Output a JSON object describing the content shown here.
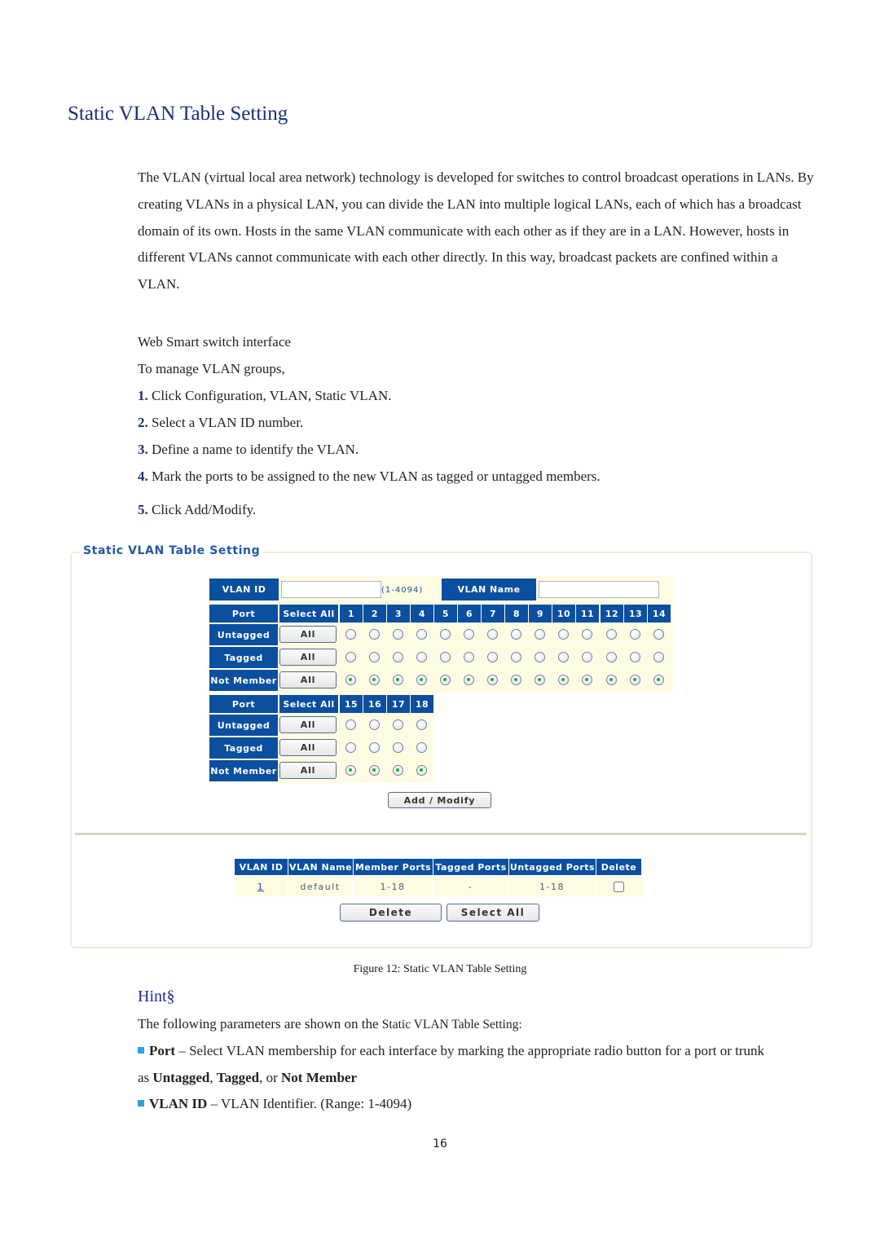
{
  "heading": "Static VLAN Table Setting",
  "intro": "The VLAN (virtual local area network) technology is developed for switches to control broadcast operations in LANs. By creating VLANs in a physical LAN, you can divide the LAN into multiple logical LANs, each of which has a broadcast domain of its own. Hosts in the same VLAN communicate with each other as if they are in a LAN. However, hosts in different VLANs cannot communicate with each other directly. In this way, broadcast packets are confined within a VLAN.",
  "interface_label": "Web Smart switch interface",
  "manage_label": "To manage VLAN groups,",
  "steps": [
    {
      "num": "1.",
      "text": "Click Configuration, VLAN, Static VLAN."
    },
    {
      "num": "2.",
      "text": "Select a VLAN ID number."
    },
    {
      "num": "3.",
      "text": "Define a name to identify the VLAN."
    },
    {
      "num": "4.",
      "text": "Mark the ports to be assigned to the new VLAN as tagged or untagged members."
    },
    {
      "num": "5.",
      "text": "Click Add/Modify."
    }
  ],
  "figure": {
    "legend": "Static VLAN Table Setting",
    "vlan_id_label": "VLAN ID",
    "vlan_id_value": "",
    "vlan_id_range": "(1-4094)",
    "vlan_name_label": "VLAN Name",
    "vlan_name_value": "",
    "port_label": "Port",
    "select_all_label": "Select All",
    "row_labels": [
      "Untagged",
      "Tagged",
      "Not Member"
    ],
    "all_button": "All",
    "port_groups": [
      {
        "ports": [
          "1",
          "2",
          "3",
          "4",
          "5",
          "6",
          "7",
          "8",
          "9",
          "10",
          "11",
          "12",
          "13",
          "14"
        ]
      },
      {
        "ports": [
          "15",
          "16",
          "17",
          "18"
        ]
      }
    ],
    "selected_row": "Not Member",
    "add_modify_button": "Add / Modify",
    "table": {
      "headers": [
        "VLAN ID",
        "VLAN Name",
        "Member Ports",
        "Tagged Ports",
        "Untagged Ports",
        "Delete"
      ],
      "rows": [
        {
          "vlan_id": "1",
          "vlan_name": "default",
          "member_ports": "1-18",
          "tagged_ports": "-",
          "untagged_ports": "1-18",
          "delete": false
        }
      ]
    },
    "delete_button": "Delete",
    "select_all_button": "Select All",
    "caption": "Figure 12: Static VLAN Table Setting"
  },
  "hint": {
    "title": "Hint§",
    "intro_prefix": "The following parameters are shown on the ",
    "intro_name": "Static VLAN Table Setting:",
    "items": [
      {
        "term": "Port",
        "desc": " – Select VLAN membership for each interface by marking the appropriate radio button for a port or trunk",
        "cont_prefix": "as ",
        "opt1": "Untagged",
        "sep1": ", ",
        "opt2": "Tagged",
        "sep2": ", or ",
        "opt3": "Not Member"
      },
      {
        "term": "VLAN ID",
        "desc": " – VLAN Identifier. (Range: 1-4094)"
      }
    ]
  },
  "page_number": "16",
  "colors": {
    "header_blue": "#0a4fa0",
    "cream": "#fefbe3",
    "title_blue": "#18307a",
    "radio_selected": "#1fae2b"
  }
}
